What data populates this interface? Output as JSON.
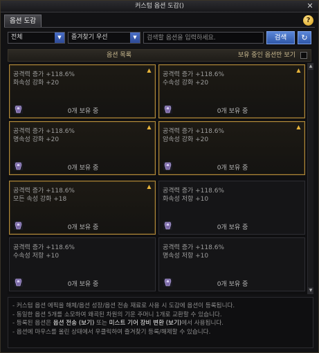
{
  "window": {
    "title": "커스텀 옵션 도감()",
    "close_label": "✕"
  },
  "tab": {
    "label": "옵션 도감"
  },
  "help": {
    "label": "?"
  },
  "filters": {
    "category_value": "전체",
    "sort_value": "즐겨찾기 우선",
    "search_placeholder": "검색할 옵션을 입력하세요.",
    "search_label": "검색",
    "refresh_icon": "↻"
  },
  "list": {
    "title": "옵션 목록",
    "owned_only_label": "보유 중인 옵션만 보기"
  },
  "cards": [
    {
      "stat1": "공격력 증가 +118.6%",
      "stat2": "화속성 강화 +20",
      "count": "0개 보유 중",
      "favorite": true
    },
    {
      "stat1": "공격력 증가 +118.6%",
      "stat2": "수속성 강화 +20",
      "count": "0개 보유 중",
      "favorite": true
    },
    {
      "stat1": "공격력 증가 +118.6%",
      "stat2": "명속성 강화 +20",
      "count": "0개 보유 중",
      "favorite": true
    },
    {
      "stat1": "공격력 증가 +118.6%",
      "stat2": "암속성 강화 +20",
      "count": "0개 보유 중",
      "favorite": true
    },
    {
      "stat1": "공격력 증가 +118.6%",
      "stat2": "모든 속성 강화 +18",
      "count": "0개 보유 중",
      "favorite": true
    },
    {
      "stat1": "공격력 증가 +118.6%",
      "stat2": "화속성 저항 +10",
      "count": "0개 보유 중",
      "favorite": false
    },
    {
      "stat1": "공격력 증가 +118.6%",
      "stat2": "수속성 저항 +10",
      "count": "0개 보유 중",
      "favorite": false
    },
    {
      "stat1": "공격력 증가 +118.6%",
      "stat2": "명속성 저항 +10",
      "count": "0개 보유 중",
      "favorite": false
    }
  ],
  "footer": {
    "line1": "- 커스텀 옵션 에픽을 해체/옵션 성장/옵션 전송 재료로 사용 시 도감에 옵션이 등록됩니다.",
    "line2": "- 동일한 옵션 5개를 소모하여 왜곡된 차원의 기운 주머니 1개로 교환할 수 있습니다.",
    "line3_a": "- 등록된 옵션은 ",
    "line3_b": "옵션 전송 (보기)",
    "line3_c": " 또는 ",
    "line3_d": "미스트 기어 장비 변환 (보기)",
    "line3_e": "에서 사용됩니다.",
    "line4": "- 옵션에 마우스를 올린 상태에서 우클릭하여 즐겨찾기 등록/해제할 수 있습니다."
  },
  "colors": {
    "gold_border": "#b08a3a",
    "button_blue": "#3f6bc0",
    "favorite_icon": "#e8b43a"
  }
}
